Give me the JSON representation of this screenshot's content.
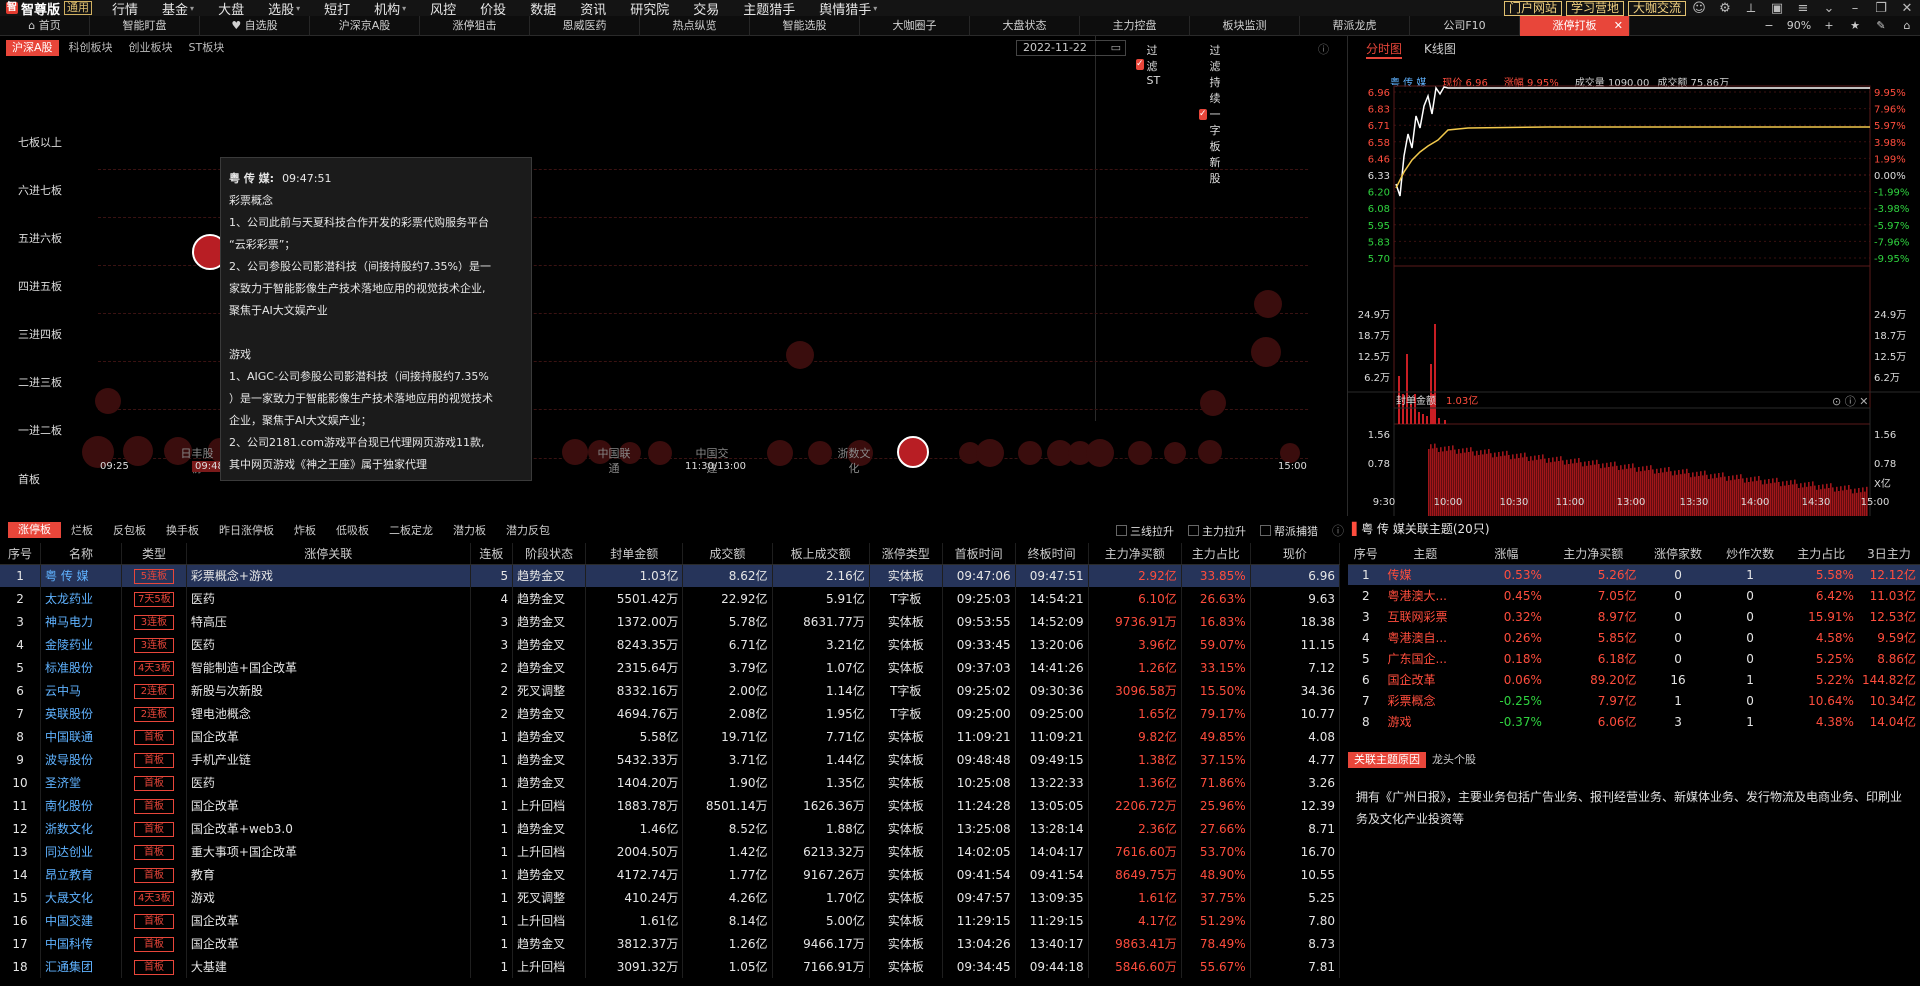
{
  "menu": {
    "app_name": "智尊版",
    "version_tag": "通用",
    "items": [
      {
        "label": "行情",
        "has_arrow": false
      },
      {
        "label": "基金",
        "has_arrow": true
      },
      {
        "label": "大盘",
        "has_arrow": false
      },
      {
        "label": "选股",
        "has_arrow": true
      },
      {
        "label": "短打",
        "has_arrow": false
      },
      {
        "label": "机构",
        "has_arrow": true
      },
      {
        "label": "风控",
        "has_arrow": false
      },
      {
        "label": "价投",
        "has_arrow": false
      },
      {
        "label": "数据",
        "has_arrow": false
      },
      {
        "label": "资讯",
        "has_arrow": false
      },
      {
        "label": "研究院",
        "has_arrow": false
      },
      {
        "label": "交易",
        "has_arrow": false
      },
      {
        "label": "主题猎手",
        "has_arrow": false
      },
      {
        "label": "舆情猎手",
        "has_arrow": true
      }
    ],
    "right_buttons": [
      "门户网站",
      "学习营地",
      "大咖交流"
    ]
  },
  "tabs": {
    "items": [
      "首页",
      "智能盯盘",
      "自选股",
      "沪深京A股",
      "涨停狙击",
      "恩威医药",
      "热点纵览",
      "智能选股",
      "大咖圈子",
      "大盘状态",
      "主力控盘",
      "板块监测",
      "帮派龙虎",
      "公司F10",
      "涨停打板"
    ],
    "active_index": 14,
    "zoom": "90%"
  },
  "chart_panel": {
    "markets": [
      "沪深A股",
      "科创板块",
      "创业板块",
      "ST板块"
    ],
    "active_market": 0,
    "date": "2022-11-22",
    "filter_st": "过滤ST",
    "filter_yizi": "过滤持续一字板新股",
    "row_labels": [
      "七板以上",
      "六进七板",
      "五进六板",
      "四进五板",
      "三进四板",
      "二进三板",
      "一进二板",
      "首板"
    ],
    "time_ticks": [
      "09:25",
      "09:48:10",
      "11:30/13:00",
      "15:00"
    ],
    "bubble_labels": [
      "日丰股份",
      "中国联通",
      "中国交建",
      "浙数文化"
    ],
    "highlight_bubble": "粤传媒"
  },
  "tooltip": {
    "stock": "粤 传 媒:",
    "time": "09:47:51",
    "lines": [
      "彩票概念",
      "1、公司此前与天夏科技合作开发的彩票代购服务平台",
      "“云彩彩票”；",
      "2、公司参股公司影潜科技（间接持股约7.35%）是一",
      "家致力于智能影像生产技术落地应用的视觉技术企业,",
      "聚焦于AI大文娱产业",
      "",
      "游戏",
      "1、AIGC-公司参股公司影潜科技（间接持股约7.35%",
      "）是一家致力于智能影像生产技术落地应用的视觉技术",
      "企业，聚焦于AI大文娱产业；",
      "2、公司2181.com游戏平台现已代理网页游戏11款,",
      "其中网页游戏《神之王座》属于独家代理"
    ]
  },
  "quote": {
    "tabs": [
      "分时图",
      "K线图"
    ],
    "name": "粤 传 媒",
    "price_label": "现价",
    "price": "6.96",
    "change_label": "涨幅",
    "change": "9.95%",
    "volume_label": "成交量",
    "volume": "1090.00",
    "amount_label": "成交额",
    "amount": "75.86万",
    "y_left": [
      "6.96",
      "6.83",
      "6.71",
      "6.58",
      "6.46",
      "6.33",
      "6.20",
      "6.08",
      "5.95",
      "5.83",
      "5.70"
    ],
    "y_right": [
      "9.95%",
      "7.96%",
      "5.97%",
      "3.98%",
      "1.99%",
      "0.00%",
      "-1.99%",
      "-3.98%",
      "-5.97%",
      "-7.96%",
      "-9.95%"
    ],
    "vol_left": [
      "24.9万",
      "18.7万",
      "12.5万",
      "6.2万"
    ],
    "vol_right": [
      "24.9万",
      "18.7万",
      "12.5万",
      "6.2万"
    ],
    "seal_label": "封单金额",
    "seal_value": "1.03亿",
    "seal_ticks": [
      "1.56",
      "0.78"
    ],
    "seal_unit": "X亿",
    "time_axis": [
      "9:30",
      "10:00",
      "10:30",
      "11:00",
      "13:00",
      "13:30",
      "14:00",
      "14:30",
      "15:00"
    ]
  },
  "table": {
    "tabs": [
      "涨停板",
      "烂板",
      "反包板",
      "换手板",
      "昨日涨停板",
      "炸板",
      "低吸板",
      "二板定龙",
      "潜力板",
      "潜力反包"
    ],
    "active_tab": 0,
    "checks": [
      "三线拉升",
      "主力拉升",
      "帮派捕猎"
    ],
    "headers": [
      "序号",
      "名称",
      "类型",
      "涨停关联",
      "连板",
      "阶段状态",
      "封单金额",
      "成交额",
      "板上成交额",
      "涨停类型",
      "首板时间",
      "终板时间",
      "主力净买额",
      "主力占比",
      "现价"
    ],
    "rows": [
      [
        "1",
        "粤 传 媒",
        "5连板",
        "彩票概念+游戏",
        "5",
        "趋势金叉",
        "1.03亿",
        "8.62亿",
        "2.16亿",
        "实体板",
        "09:47:06",
        "09:47:51",
        "2.92亿",
        "33.85%",
        "6.96"
      ],
      [
        "2",
        "太龙药业",
        "7天5板",
        "医药",
        "4",
        "趋势金叉",
        "5501.42万",
        "22.92亿",
        "5.91亿",
        "T字板",
        "09:25:03",
        "14:54:21",
        "6.10亿",
        "26.63%",
        "9.63"
      ],
      [
        "3",
        "神马电力",
        "3连板",
        "特高压",
        "3",
        "趋势金叉",
        "1372.00万",
        "5.78亿",
        "8631.77万",
        "实体板",
        "09:53:55",
        "14:52:09",
        "9736.91万",
        "16.83%",
        "18.38"
      ],
      [
        "4",
        "金陵药业",
        "3连板",
        "医药",
        "3",
        "趋势金叉",
        "8243.35万",
        "6.71亿",
        "3.21亿",
        "实体板",
        "09:33:45",
        "13:20:06",
        "3.96亿",
        "59.07%",
        "11.15"
      ],
      [
        "5",
        "标准股份",
        "4天3板",
        "智能制造+国企改革",
        "2",
        "趋势金叉",
        "2315.64万",
        "3.79亿",
        "1.07亿",
        "实体板",
        "09:37:03",
        "14:41:26",
        "1.26亿",
        "33.15%",
        "7.12"
      ],
      [
        "6",
        "云中马",
        "2连板",
        "新股与次新股",
        "2",
        "死叉调整",
        "8332.16万",
        "2.00亿",
        "1.14亿",
        "T字板",
        "09:25:02",
        "09:30:36",
        "3096.58万",
        "15.50%",
        "34.36"
      ],
      [
        "7",
        "英联股份",
        "2连板",
        "锂电池概念",
        "2",
        "趋势金叉",
        "4694.76万",
        "2.08亿",
        "1.95亿",
        "T字板",
        "09:25:00",
        "09:25:00",
        "1.65亿",
        "79.17%",
        "10.77"
      ],
      [
        "8",
        "中国联通",
        "首板",
        "国企改革",
        "1",
        "趋势金叉",
        "5.58亿",
        "19.71亿",
        "7.71亿",
        "实体板",
        "11:09:21",
        "11:09:21",
        "9.82亿",
        "49.85%",
        "4.08"
      ],
      [
        "9",
        "波导股份",
        "首板",
        "手机产业链",
        "1",
        "趋势金叉",
        "5432.33万",
        "3.71亿",
        "1.44亿",
        "实体板",
        "09:48:48",
        "09:49:15",
        "1.38亿",
        "37.15%",
        "4.77"
      ],
      [
        "10",
        "圣济堂",
        "首板",
        "医药",
        "1",
        "趋势金叉",
        "1404.20万",
        "1.90亿",
        "1.35亿",
        "实体板",
        "10:25:08",
        "13:22:33",
        "1.36亿",
        "71.86%",
        "3.26"
      ],
      [
        "11",
        "南化股份",
        "首板",
        "国企改革",
        "1",
        "上升回档",
        "1883.78万",
        "8501.14万",
        "1626.36万",
        "实体板",
        "11:24:28",
        "13:05:05",
        "2206.72万",
        "25.96%",
        "12.39"
      ],
      [
        "12",
        "浙数文化",
        "首板",
        "国企改革+web3.0",
        "1",
        "趋势金叉",
        "1.46亿",
        "8.52亿",
        "1.88亿",
        "实体板",
        "13:25:08",
        "13:28:14",
        "2.36亿",
        "27.66%",
        "8.71"
      ],
      [
        "13",
        "同达创业",
        "首板",
        "重大事项+国企改革",
        "1",
        "上升回档",
        "2004.50万",
        "1.42亿",
        "6213.32万",
        "实体板",
        "14:02:05",
        "14:04:17",
        "7616.60万",
        "53.70%",
        "16.70"
      ],
      [
        "14",
        "昂立教育",
        "首板",
        "教育",
        "1",
        "趋势金叉",
        "4172.74万",
        "1.77亿",
        "9167.26万",
        "实体板",
        "09:41:54",
        "09:41:54",
        "8649.75万",
        "48.90%",
        "10.55"
      ],
      [
        "15",
        "大晟文化",
        "4天3板",
        "游戏",
        "1",
        "死叉调整",
        "410.24万",
        "4.26亿",
        "1.70亿",
        "实体板",
        "09:47:57",
        "13:09:35",
        "1.61亿",
        "37.75%",
        "5.25"
      ],
      [
        "16",
        "中国交建",
        "首板",
        "国企改革",
        "1",
        "上升回档",
        "1.61亿",
        "8.14亿",
        "5.00亿",
        "实体板",
        "11:29:15",
        "11:29:15",
        "4.17亿",
        "51.29%",
        "7.80"
      ],
      [
        "17",
        "中国科传",
        "首板",
        "国企改革",
        "1",
        "趋势金叉",
        "3812.37万",
        "1.26亿",
        "9466.17万",
        "实体板",
        "13:04:26",
        "13:40:17",
        "9863.41万",
        "78.49%",
        "8.73"
      ],
      [
        "18",
        "汇通集团",
        "首板",
        "大基建",
        "1",
        "上升回档",
        "3091.32万",
        "1.05亿",
        "7166.91万",
        "实体板",
        "09:34:45",
        "09:44:18",
        "5846.60万",
        "55.67%",
        "7.81"
      ]
    ]
  },
  "themes": {
    "title": "粤 传 媒关联主题(20只)",
    "headers": [
      "序号",
      "主题",
      "涨幅",
      "主力净买额",
      "涨停家数",
      "炒作次数",
      "主力占比",
      "3日主力"
    ],
    "rows": [
      [
        "1",
        "传媒",
        "0.53%",
        "5.26亿",
        "0",
        "1",
        "5.58%",
        "12.12亿"
      ],
      [
        "2",
        "粤港澳大...",
        "0.45%",
        "7.05亿",
        "0",
        "0",
        "6.42%",
        "11.03亿"
      ],
      [
        "3",
        "互联网彩票",
        "0.32%",
        "8.97亿",
        "0",
        "0",
        "15.91%",
        "12.53亿"
      ],
      [
        "4",
        "粤港澳自...",
        "0.26%",
        "5.85亿",
        "0",
        "0",
        "4.58%",
        "9.59亿"
      ],
      [
        "5",
        "广东国企...",
        "0.18%",
        "6.18亿",
        "0",
        "0",
        "5.25%",
        "8.86亿"
      ],
      [
        "6",
        "国企改革",
        "0.06%",
        "89.20亿",
        "16",
        "1",
        "5.22%",
        "144.82亿"
      ],
      [
        "7",
        "彩票概念",
        "-0.25%",
        "7.97亿",
        "1",
        "0",
        "10.64%",
        "10.34亿"
      ],
      [
        "8",
        "游戏",
        "-0.37%",
        "6.06亿",
        "3",
        "1",
        "4.38%",
        "14.04亿"
      ]
    ],
    "reason_tabs": [
      "关联主题原因",
      "龙头个股"
    ],
    "reason_text": "拥有《广州日报》，主要业务包括广告业务、报刊经营业务、新媒体业务、发行物流及电商业务、印刷业务及文化产业投资等"
  },
  "colors": {
    "accent": "#e8463a",
    "up": "#ff4d3d",
    "down": "#2fd33f",
    "name": "#5fb2ff",
    "select": "#26345a"
  }
}
